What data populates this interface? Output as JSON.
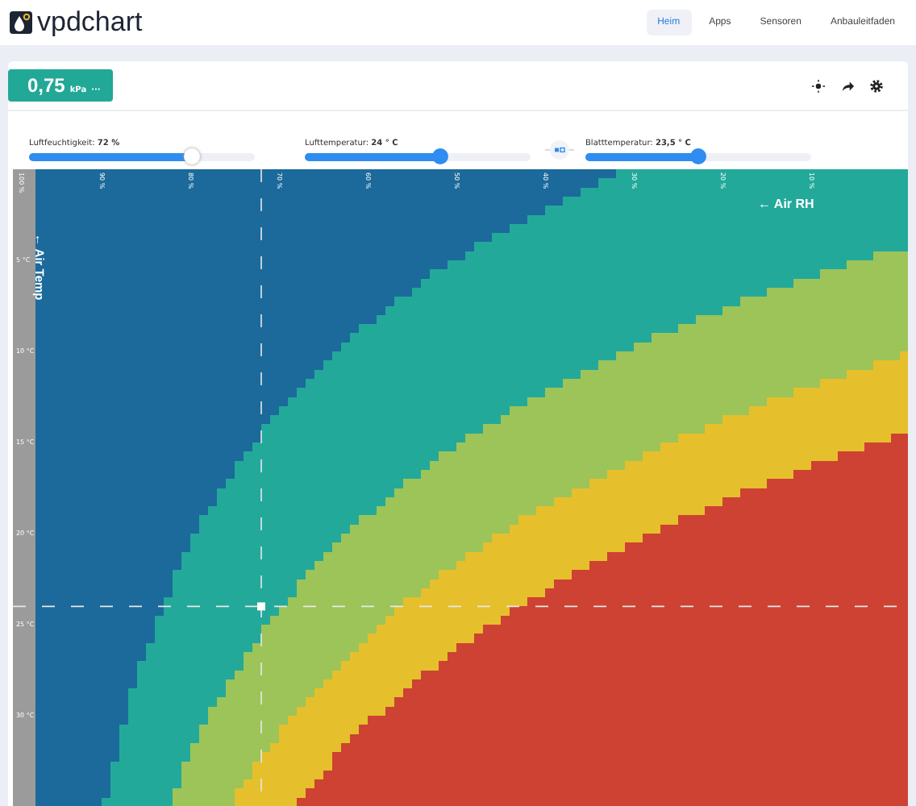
{
  "brand": {
    "name": "vpdchart"
  },
  "nav": [
    {
      "label": "Heim",
      "selected": true
    },
    {
      "label": "Apps",
      "selected": false
    },
    {
      "label": "Sensoren",
      "selected": false
    },
    {
      "label": "Anbauleitfaden",
      "selected": false
    }
  ],
  "reading": {
    "value": "0,75",
    "unit": "kPa",
    "more": "···"
  },
  "sliders": [
    {
      "label": "Luftfeuchtigkeit:",
      "value": "72 %",
      "level": 0.72
    },
    {
      "label": "Lufttemperatur:",
      "value": "24 ° C",
      "level": 0.6
    },
    {
      "label": "Blatttemperatur:",
      "value": "23,5 ° C",
      "level": 0.5
    }
  ],
  "chart": {
    "x_title": "← Air RH",
    "y_title": "← Air Temp",
    "x_ticks": [
      "100 %",
      "90 %",
      "80 %",
      "70 %",
      "60 %",
      "50 %",
      "40 %",
      "30 %",
      "20 %",
      "10 %"
    ],
    "y_ticks": [
      "5 °C",
      "10 °C",
      "15 °C",
      "20 °C",
      "25 °C",
      "30 °C"
    ]
  }
}
